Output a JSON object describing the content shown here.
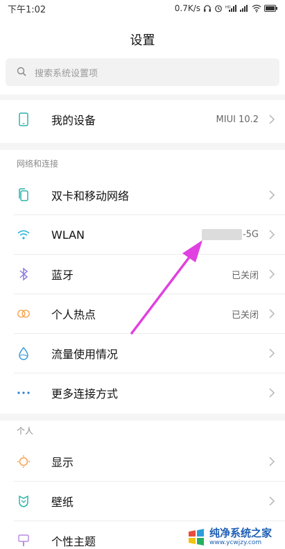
{
  "status_bar": {
    "time": "下午1:02",
    "speed": "0.7K/s"
  },
  "header": {
    "title": "设置"
  },
  "search": {
    "placeholder": "搜索系统设置项"
  },
  "device": {
    "label": "我的设备",
    "value": "MIUI 10.2"
  },
  "sections": {
    "network": {
      "header": "网络和连接",
      "items": [
        {
          "label": "双卡和移动网络",
          "value": "",
          "icon": "sim-icon"
        },
        {
          "label": "WLAN",
          "value": "-5G",
          "icon": "wifi-icon"
        },
        {
          "label": "蓝牙",
          "value": "已关闭",
          "icon": "bluetooth-icon"
        },
        {
          "label": "个人热点",
          "value": "已关闭",
          "icon": "hotspot-icon"
        },
        {
          "label": "流量使用情况",
          "value": "",
          "icon": "data-usage-icon"
        },
        {
          "label": "更多连接方式",
          "value": "",
          "icon": "more-icon"
        }
      ]
    },
    "personal": {
      "header": "个人",
      "items": [
        {
          "label": "显示",
          "icon": "display-icon"
        },
        {
          "label": "壁纸",
          "icon": "wallpaper-icon"
        },
        {
          "label": "个性主题",
          "icon": "theme-icon"
        }
      ]
    }
  },
  "watermark": {
    "main": "纯净系统之家",
    "sub": "www.ycwjzy.com"
  },
  "colors": {
    "device_icon": "#2bb3a8",
    "sim_icon": "#2bb3a8",
    "wifi_icon": "#29b2d8",
    "bluetooth_icon": "#8a7bdc",
    "hotspot_icon": "#f5a04a",
    "data_icon": "#3a9bdc",
    "more_icon": "#2f7fd6",
    "display_icon": "#f5a04a",
    "wallpaper_icon": "#2bb3a8",
    "theme_icon": "#b98be0",
    "arrow": "#e040e0"
  }
}
